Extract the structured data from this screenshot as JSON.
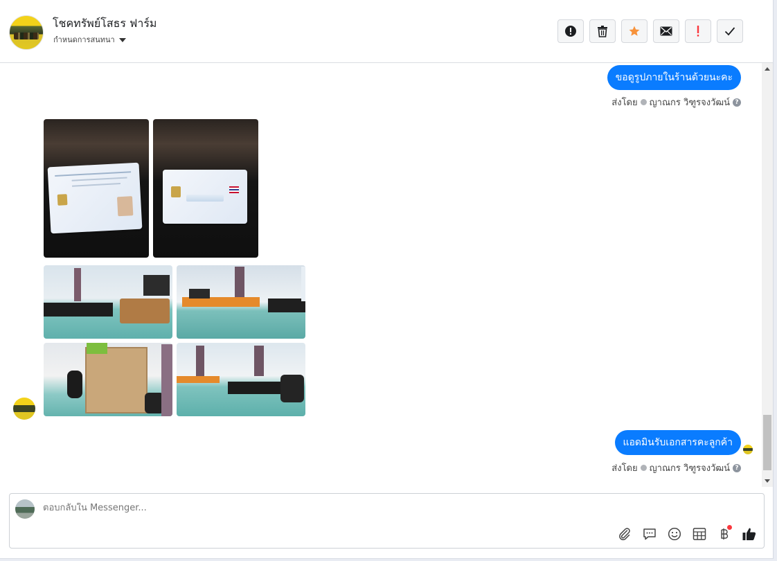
{
  "header": {
    "page_name": "โชคทรัพย์โสธร ฟาร์ม",
    "assign_label": "กำหนดการสนทนา",
    "toolbar": [
      {
        "name": "report-spam-button",
        "icon": "exclamation-circle-icon"
      },
      {
        "name": "delete-button",
        "icon": "trash-icon"
      },
      {
        "name": "star-button",
        "icon": "star-icon",
        "color": "#f7923a"
      },
      {
        "name": "mark-unread-button",
        "icon": "envelope-icon"
      },
      {
        "name": "follow-up-button",
        "icon": "exclamation-icon",
        "color": "#fa383e"
      },
      {
        "name": "mark-done-button",
        "icon": "checkmark-icon"
      }
    ]
  },
  "messages": {
    "first": {
      "text": "ขอดูรูปภายในร้านด้วยนะคะ",
      "sent_by_label": "ส่งโดย",
      "sender": "ญาณกร วิฑูรจงวัฒน์"
    },
    "second": {
      "text": "แอดมินรับเอกสารคะลูกค้า",
      "sent_by_label": "ส่งโดย",
      "sender": "ญาณกร วิฑูรจงวัฒน์"
    }
  },
  "composer": {
    "placeholder": "ตอบกลับใน Messenger...",
    "icons": [
      "paperclip-icon",
      "saved-reply-icon",
      "emoji-icon",
      "table-icon",
      "baht-icon",
      "thumbs-up-icon"
    ]
  },
  "colors": {
    "bubble": "#0a7cff",
    "accent_star": "#f7923a",
    "alert_red": "#fa383e"
  }
}
